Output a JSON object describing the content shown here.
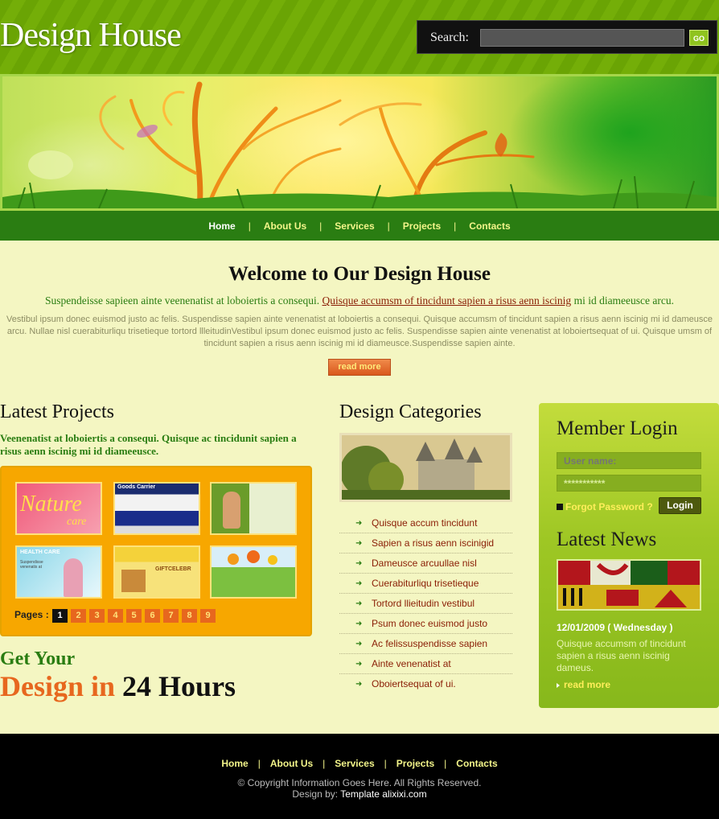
{
  "header": {
    "logo": "Design House",
    "search_label": "Search:",
    "search_placeholder": "",
    "go_label": "GO"
  },
  "nav": {
    "items": [
      "Home",
      "About Us",
      "Services",
      "Projects",
      "Contacts"
    ],
    "separator": "|"
  },
  "welcome": {
    "title": "Welcome to Our Design House",
    "lead_prefix": "Suspendeisse sapieen ainte veenenatist at loboiertis a consequi.",
    "lead_link": "Quisque accumsm of tincidunt sapien a risus aenn iscinig",
    "lead_suffix": "mi id diameeusce arcu.",
    "body": "Vestibul ipsum donec euismod justo ac felis. Suspendisse sapien ainte venenatist at loboiertis a consequi. Quisque accumsm of tincidunt sapien a risus aenn iscinig mi id dameusce arcu. Nullae nisl cuerabiturliqu trisetieque tortord llleitudinVestibul ipsum donec euismod justo ac felis. Suspendisse sapien ainte venenatist at loboiertsequat of ui. Quisque umsm of tincidunt sapien a risus aenn iscinig mi id diameusce.Suspendisse sapien ainte.",
    "read_more": "read more"
  },
  "projects": {
    "title": "Latest Projects",
    "lead": "Veenenatist at loboiertis a consequi. Quisque ac tincidunit sapien a risus aenn iscinig mi id diameeusce.",
    "thumbs": [
      {
        "label": "Nature",
        "sub": "care"
      },
      {
        "label": "Goods Carrier",
        "sub": ""
      },
      {
        "label": "",
        "sub": ""
      },
      {
        "label": "HEALTH CARE",
        "sub": "Suspendisse venenatis at"
      },
      {
        "label": "GIFTCELEBR",
        "sub": ""
      },
      {
        "label": "",
        "sub": ""
      }
    ],
    "pages_label": "Pages :",
    "pages": [
      "1",
      "2",
      "3",
      "4",
      "5",
      "6",
      "7",
      "8",
      "9"
    ]
  },
  "promo": {
    "line1": "Get Your",
    "line2_a": "Design in",
    "line2_b": "24 Hours"
  },
  "categories": {
    "title": "Design Categories",
    "items": [
      "Quisque accum tincidunt",
      "Sapien a risus aenn iscinigid",
      "Dameusce arcuullae nisl",
      "Cuerabiturliqu trisetieque",
      "Tortord llieitudin vestibul",
      "Psum donec euismod justo",
      "Ac felissuspendisse sapien",
      "Ainte venenatist at",
      "Oboiertsequat of ui."
    ]
  },
  "login": {
    "title": "Member Login",
    "username_placeholder": "User name:",
    "password_value": "***********",
    "forgot": "Forgot Password ?",
    "login_label": "Login"
  },
  "news": {
    "title": "Latest News",
    "date": "12/01/2009 ( Wednesday )",
    "text": "Quisque accumsm of tincidunt sapien a risus aenn iscinig dameus.",
    "read_more": "read more"
  },
  "footer": {
    "nav": [
      "Home",
      "About Us",
      "Services",
      "Projects",
      "Contacts"
    ],
    "copyright": "© Copyright Information Goes Here. All Rights Reserved.",
    "design_by_prefix": "Design by:",
    "design_by_link": "Template alixixi.com"
  },
  "colors": {
    "header_green": "#6aa404",
    "nav_green": "#2a7d12",
    "page_bg": "#f4f6c2",
    "orange": "#f7a700",
    "accent": "#e7671e",
    "footer": "#000000"
  }
}
